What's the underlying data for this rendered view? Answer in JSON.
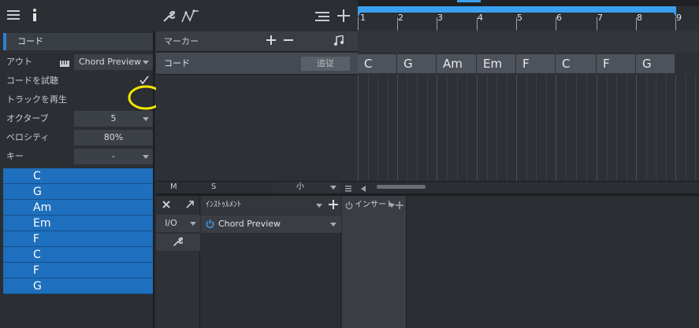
{
  "inspector": {
    "title": "コード",
    "rows": [
      {
        "label": "アウト",
        "value": "Chord Preview",
        "dropdown": true,
        "keyboard_icon": true
      },
      {
        "label": "コードを試聴",
        "check": true
      },
      {
        "label": "トラックを再生",
        "check": false
      },
      {
        "label": "オクターブ",
        "value": "5",
        "dropdown": true
      },
      {
        "label": "ベロシティ",
        "value": "80%",
        "dropdown": false
      },
      {
        "label": "キー",
        "value": "-",
        "dropdown": true
      }
    ],
    "chords": [
      "C",
      "G",
      "Am",
      "Em",
      "F",
      "C",
      "F",
      "G"
    ]
  },
  "tracks": {
    "marker_label": "マーカー",
    "chord_label": "コード",
    "follow_button": "追従"
  },
  "ruler": {
    "bars": [
      "1",
      "2",
      "3",
      "4",
      "5",
      "6",
      "7",
      "8",
      "9"
    ]
  },
  "chord_events": [
    "C",
    "G",
    "Am",
    "Em",
    "F",
    "C",
    "F",
    "G"
  ],
  "track_footer": {
    "mute": "M",
    "solo": "S",
    "size": "小"
  },
  "console": {
    "io_label": "I/O",
    "instruments_header": "ｲﾝｽﾄｩﾙﾒﾝﾄ",
    "instrument_name": "Chord Preview",
    "inserts_header": "インサート"
  },
  "colors": {
    "accent": "#1e6fbe",
    "ruler_loop": "#3aa0ee",
    "highlight_circle": "#f2e600"
  }
}
